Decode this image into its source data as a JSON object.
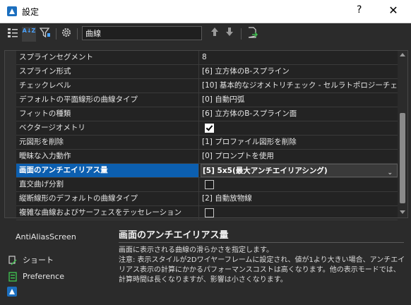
{
  "window": {
    "title": "設定",
    "help": "?",
    "close": "✕"
  },
  "toolbar": {
    "search_value": "曲線",
    "buttons": [
      "category-view-icon",
      "alphabetic-sort-icon",
      "filter-icon",
      "settings-gear-icon",
      "arrow-up-icon",
      "arrow-down-icon",
      "export-icon"
    ],
    "sort_label": "A↓Z"
  },
  "rows": [
    {
      "name": "スプラインセグメント",
      "value": "8"
    },
    {
      "name": "スプライン形式",
      "value": "[6] 立方体のB-スプライン"
    },
    {
      "name": "チェックレベル",
      "value": "[10] 基本的なジオメトリチェック - セルラトポロジーチェック"
    },
    {
      "name": "デフォルトの平面線形の曲線タイプ",
      "value": "[0] 自動円弧"
    },
    {
      "name": "フィットの種類",
      "value": "[6] 立方体のB-スプライン面"
    },
    {
      "name": "ベクタージオメトリ",
      "checked": true
    },
    {
      "name": "元図形を削除",
      "value": "[1] プロファイル図形を削除"
    },
    {
      "name": "曖昧な入力動作",
      "value": "[0] プロンプトを使用"
    },
    {
      "name": "画面のアンチエイリアス量",
      "value": "[5] 5x5(最大アンチエイリアシング)"
    },
    {
      "name": "直交曲げ分割",
      "checked": false
    },
    {
      "name": "縦断線形のデフォルトの曲線タイプ",
      "value": "[2] 自動放物線"
    },
    {
      "name": "複雑な曲線およびサーフェスをテッセレーション",
      "checked": false
    }
  ],
  "info": {
    "variable": "AntiAliasScreen",
    "links": [
      "ショート",
      "Preference"
    ],
    "title": "画面のアンチエイリアス量",
    "description": "画面に表示される曲線の滑らかさを指定します。",
    "note": "注意: 表示スタイルが2Dワイヤーフレームに設定され、値が1より大きい場合、アンチエイリアス表示の計算にかかるパフォーマンスコストは高くなります。他の表示モードでは、計算時間は長くなりますが、影響は小さくなります。"
  },
  "colors": {
    "accent": "#0c5fb0",
    "background": "#2b2b2b",
    "brand": "#1c6fbf"
  }
}
